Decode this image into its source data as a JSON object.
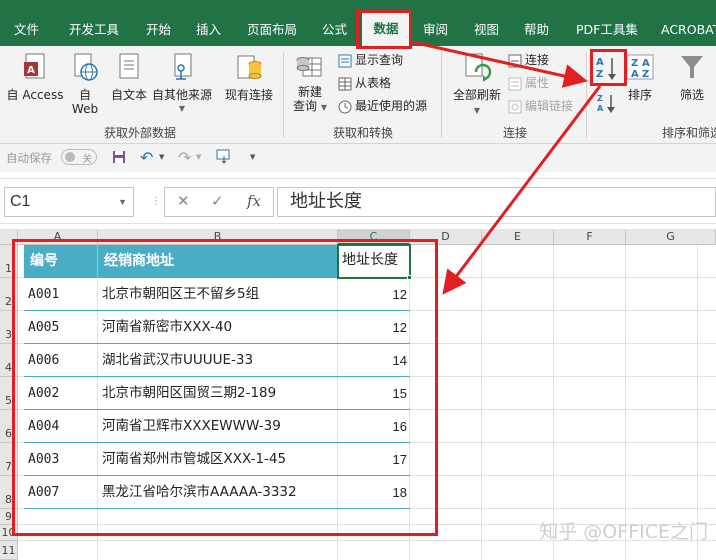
{
  "ribbon_tabs": [
    {
      "label": "文件",
      "active": false
    },
    {
      "label": "开发工具",
      "active": false
    },
    {
      "label": "开始",
      "active": false
    },
    {
      "label": "插入",
      "active": false
    },
    {
      "label": "页面布局",
      "active": false
    },
    {
      "label": "公式",
      "active": false
    },
    {
      "label": "数据",
      "active": true
    },
    {
      "label": "审阅",
      "active": false
    },
    {
      "label": "视图",
      "active": false
    },
    {
      "label": "帮助",
      "active": false
    },
    {
      "label": "PDF工具集",
      "active": false
    },
    {
      "label": "ACROBAT",
      "active": false
    }
  ],
  "ribbon": {
    "get_external": {
      "group_label": "获取外部数据",
      "access": "自 Access",
      "web_line1": "自",
      "web_line2": "Web",
      "text": "自文本",
      "other": "自其他来源",
      "existing": "现有连接"
    },
    "get_transform": {
      "group_label": "获取和转换",
      "new_query_line1": "新建",
      "new_query_line2": "查询",
      "show_queries": "显示查询",
      "from_table": "从表格",
      "recent_sources": "最近使用的源"
    },
    "connections": {
      "group_label": "连接",
      "refresh_all": "全部刷新",
      "connections": "连接",
      "properties": "属性",
      "edit_links": "编辑链接"
    },
    "sort_filter": {
      "group_label": "排序和筛选",
      "sort": "排序",
      "filter": "筛选"
    }
  },
  "qat": {
    "autosave_label": "自动保存",
    "autosave_state": "关"
  },
  "formula_bar": {
    "name_box": "C1",
    "cancel_symbol": "✕",
    "enter_symbol": "✓",
    "fx_symbol": "fx",
    "content": "地址长度"
  },
  "sheet": {
    "columns": [
      "A",
      "B",
      "C",
      "D",
      "E",
      "F",
      "G"
    ],
    "rows": [
      "1",
      "2",
      "3",
      "4",
      "5",
      "6",
      "7",
      "8",
      "9",
      "10",
      "11"
    ],
    "headers": [
      "编号",
      "经销商地址",
      "地址长度"
    ],
    "data": [
      {
        "id": "A001",
        "address": "北京市朝阳区王不留乡5组",
        "length": "12"
      },
      {
        "id": "A005",
        "address": "河南省新密市XXX-40",
        "length": "12"
      },
      {
        "id": "A006",
        "address": "湖北省武汉市UUUUE-33",
        "length": "14"
      },
      {
        "id": "A002",
        "address": "北京市朝阳区国贸三期2-189",
        "length": "15"
      },
      {
        "id": "A004",
        "address": "河南省卫辉市XXXEWWW-39",
        "length": "16"
      },
      {
        "id": "A003",
        "address": "河南省郑州市管城区XXX-1-45",
        "length": "17"
      },
      {
        "id": "A007",
        "address": "黑龙江省哈尔滨市AAAAA-3332",
        "length": "18"
      }
    ]
  },
  "watermark": "知乎 @OFFICE之门",
  "colors": {
    "excel_green": "#217346",
    "table_header": "#4bacc6",
    "annotation_red": "#e02020"
  }
}
